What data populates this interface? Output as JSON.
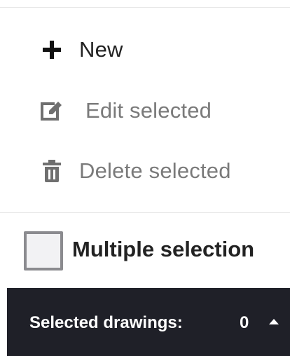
{
  "menu": {
    "items": [
      {
        "label": "New",
        "icon": "plus-icon",
        "enabled": true
      },
      {
        "label": "Edit selected",
        "icon": "edit-icon",
        "enabled": false
      },
      {
        "label": "Delete selected",
        "icon": "trash-icon",
        "enabled": false
      }
    ]
  },
  "multiple_selection": {
    "label": "Multiple selection",
    "checked": false
  },
  "status": {
    "label": "Selected drawings:",
    "count": "0",
    "toggle_icon": "caret-up-icon"
  },
  "colors": {
    "enabled_text": "#222222",
    "disabled_text": "#7a7a7a",
    "status_bar_bg": "#1f2028",
    "checkbox_border": "#8b8b8f"
  }
}
